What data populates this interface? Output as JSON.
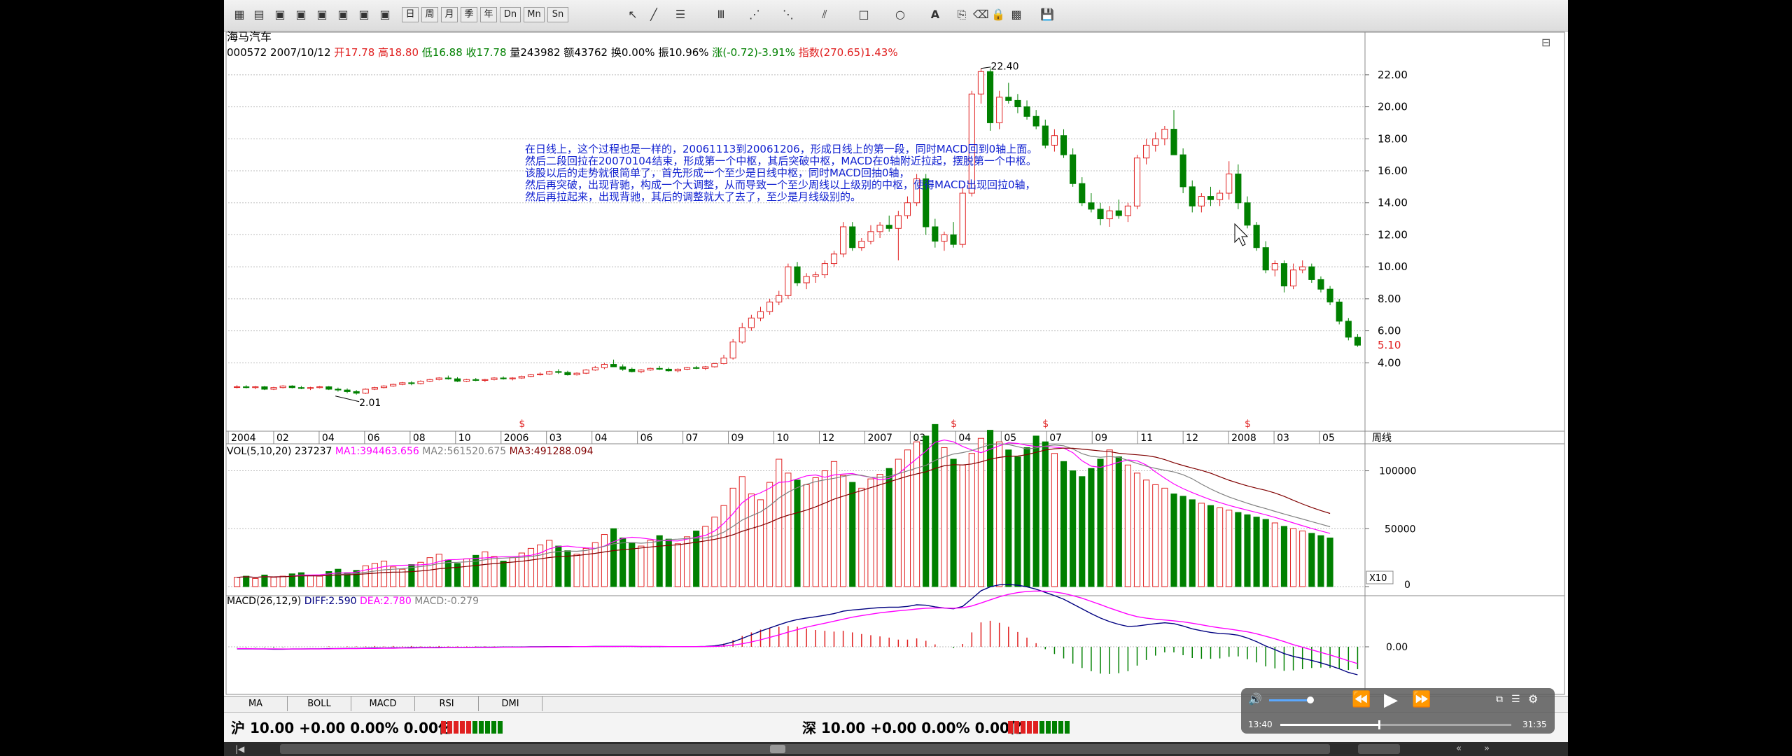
{
  "stock": {
    "name": "海马汽车",
    "code": "000572",
    "date": "2007/10/12",
    "open_label": "开",
    "open": "17.78",
    "high_label": "高",
    "high": "18.80",
    "low_label": "低",
    "low": "16.88",
    "close_label": "收",
    "close": "17.78",
    "vol_label": "量",
    "vol": "243982",
    "amount_label": "额",
    "amount": "43762",
    "turn_label": "换",
    "turn": "0.00%",
    "amp_label": "振",
    "amp": "10.96%",
    "chg_label": "涨",
    "chg": "(-0.72)-3.91%",
    "index_label": "指数",
    "index": "(270.65)1.43%"
  },
  "annotation": [
    "在日线上，这个过程也是一样的，20061113到20061206，形成日线上的第一段，同时MACD回到0轴上面。",
    "然后二段回拉在20070104结束，形成第一个中枢，其后突破中枢，MACD在0轴附近拉起，摆脱第一个中枢。",
    "该股以后的走势就很简单了，首先形成一个至少是日线中枢，同时MACD回抽0轴，",
    "然后再突破，出现背驰，构成一个大调整，从而导致一个至少周线以上级别的中枢，使得MACD出现回拉0轴，",
    "然后再拉起来，出现背驰，其后的调整就大了去了，至少是月线级别的。"
  ],
  "price_labels": {
    "peak": "22.40",
    "low": "2.01",
    "last": "5.10",
    "period": "周线"
  },
  "volume_header": {
    "title": "VOL(5,10,20)",
    "vol": "237237",
    "ma1": "MA1:394463.656",
    "ma2": "MA2:561520.675",
    "ma3": "MA3:491288.094"
  },
  "macd_header": {
    "title": "MACD(26,12,9)",
    "diff": "DIFF:2.590",
    "dea": "DEA:2.780",
    "macd": "MACD:-0.279"
  },
  "volume_axis": {
    "labels": [
      "100000",
      "50000",
      "0"
    ],
    "unit": "X10"
  },
  "macd_axis": {
    "labels": [
      "0.00"
    ]
  },
  "x_axis": {
    "labels": [
      "2004",
      "02",
      "04",
      "06",
      "08",
      "10",
      "2006",
      "03",
      "04",
      "06",
      "07",
      "09",
      "10",
      "12",
      "2007",
      "03",
      "04",
      "05",
      "07",
      "09",
      "11",
      "12",
      "2008",
      "03",
      "05"
    ]
  },
  "tabs": [
    "MA",
    "BOLL",
    "MACD",
    "RSI",
    "DMI"
  ],
  "status": {
    "sh": "沪 10.00 +0.00 0.00% 0.00亿",
    "sz": "深 10.00 +0.00 0.00% 0.00亿"
  },
  "toolbar": {
    "buttons": [
      "日",
      "周",
      "月",
      "季",
      "年",
      "Dn",
      "Mn",
      "Sn"
    ]
  },
  "player": {
    "current": "13:40",
    "total": "31:35"
  },
  "colors": {
    "up": "#e02020",
    "down": "#008000",
    "ma1": "#ff00ff",
    "ma2": "#808080",
    "ma3": "#800000",
    "diff": "#000080",
    "dea": "#ff00ff"
  },
  "chart_data": {
    "type": "candlestick",
    "title": "海马汽车",
    "price_axis": {
      "ylim": [
        2.0,
        23.0
      ],
      "ticks": [
        4,
        6,
        8,
        10,
        12,
        14,
        16,
        18,
        20,
        22
      ]
    },
    "candles": [
      [
        2.5,
        2.6,
        2.4,
        2.5
      ],
      [
        2.5,
        2.6,
        2.4,
        2.45
      ],
      [
        2.45,
        2.55,
        2.35,
        2.5
      ],
      [
        2.5,
        2.55,
        2.3,
        2.35
      ],
      [
        2.35,
        2.5,
        2.3,
        2.45
      ],
      [
        2.45,
        2.6,
        2.4,
        2.55
      ],
      [
        2.55,
        2.6,
        2.4,
        2.45
      ],
      [
        2.45,
        2.55,
        2.35,
        2.4
      ],
      [
        2.4,
        2.5,
        2.3,
        2.45
      ],
      [
        2.45,
        2.55,
        2.4,
        2.5
      ],
      [
        2.5,
        2.55,
        2.3,
        2.35
      ],
      [
        2.35,
        2.45,
        2.2,
        2.3
      ],
      [
        2.3,
        2.4,
        2.1,
        2.2
      ],
      [
        2.2,
        2.3,
        2.01,
        2.1
      ],
      [
        2.1,
        2.4,
        2.05,
        2.35
      ],
      [
        2.35,
        2.5,
        2.3,
        2.45
      ],
      [
        2.45,
        2.6,
        2.4,
        2.55
      ],
      [
        2.55,
        2.7,
        2.5,
        2.65
      ],
      [
        2.65,
        2.8,
        2.6,
        2.75
      ],
      [
        2.75,
        2.85,
        2.6,
        2.7
      ],
      [
        2.7,
        2.9,
        2.65,
        2.85
      ],
      [
        2.85,
        3.0,
        2.8,
        2.95
      ],
      [
        2.95,
        3.1,
        2.9,
        3.05
      ],
      [
        3.05,
        3.2,
        2.95,
        3.0
      ],
      [
        3.0,
        3.1,
        2.8,
        2.85
      ],
      [
        2.85,
        3.0,
        2.8,
        2.95
      ],
      [
        2.95,
        3.05,
        2.85,
        2.9
      ],
      [
        2.9,
        3.0,
        2.8,
        2.95
      ],
      [
        2.95,
        3.1,
        2.9,
        3.05
      ],
      [
        3.05,
        3.15,
        2.95,
        3.0
      ],
      [
        3.0,
        3.1,
        2.9,
        3.05
      ],
      [
        3.05,
        3.2,
        3.0,
        3.15
      ],
      [
        3.15,
        3.3,
        3.1,
        3.25
      ],
      [
        3.25,
        3.4,
        3.2,
        3.3
      ],
      [
        3.3,
        3.5,
        3.25,
        3.45
      ],
      [
        3.45,
        3.6,
        3.3,
        3.4
      ],
      [
        3.4,
        3.5,
        3.2,
        3.25
      ],
      [
        3.25,
        3.4,
        3.2,
        3.35
      ],
      [
        3.35,
        3.6,
        3.3,
        3.55
      ],
      [
        3.55,
        3.8,
        3.5,
        3.7
      ],
      [
        3.7,
        4.0,
        3.6,
        3.9
      ],
      [
        3.9,
        4.2,
        3.8,
        3.75
      ],
      [
        3.75,
        3.9,
        3.5,
        3.6
      ],
      [
        3.6,
        3.7,
        3.4,
        3.45
      ],
      [
        3.45,
        3.6,
        3.35,
        3.55
      ],
      [
        3.55,
        3.7,
        3.5,
        3.65
      ],
      [
        3.65,
        3.8,
        3.55,
        3.6
      ],
      [
        3.6,
        3.7,
        3.45,
        3.5
      ],
      [
        3.5,
        3.65,
        3.4,
        3.6
      ],
      [
        3.6,
        3.75,
        3.55,
        3.7
      ],
      [
        3.7,
        3.8,
        3.6,
        3.65
      ],
      [
        3.65,
        3.8,
        3.55,
        3.75
      ],
      [
        3.75,
        4.0,
        3.7,
        3.95
      ],
      [
        3.95,
        4.5,
        3.9,
        4.3
      ],
      [
        4.3,
        5.5,
        4.2,
        5.3
      ],
      [
        5.3,
        6.5,
        5.2,
        6.2
      ],
      [
        6.2,
        7.0,
        6.0,
        6.8
      ],
      [
        6.8,
        7.5,
        6.6,
        7.2
      ],
      [
        7.2,
        8.0,
        7.0,
        7.8
      ],
      [
        7.8,
        8.5,
        7.6,
        8.2
      ],
      [
        8.2,
        10.2,
        8.0,
        10.0
      ],
      [
        10.0,
        10.3,
        8.8,
        9.0
      ],
      [
        9.0,
        9.6,
        8.6,
        9.4
      ],
      [
        9.4,
        9.7,
        9.0,
        9.5
      ],
      [
        9.5,
        10.4,
        9.3,
        10.2
      ],
      [
        10.2,
        11.0,
        10.0,
        10.8
      ],
      [
        10.8,
        12.8,
        10.6,
        12.5
      ],
      [
        12.5,
        12.8,
        11.0,
        11.2
      ],
      [
        11.2,
        11.8,
        11.0,
        11.6
      ],
      [
        11.6,
        12.6,
        11.4,
        12.2
      ],
      [
        12.2,
        12.8,
        11.8,
        12.6
      ],
      [
        12.6,
        13.2,
        12.2,
        12.4
      ],
      [
        12.4,
        13.5,
        10.4,
        13.2
      ],
      [
        13.2,
        14.4,
        13.0,
        14.0
      ],
      [
        14.0,
        15.8,
        13.8,
        15.5
      ],
      [
        15.5,
        15.8,
        12.0,
        12.5
      ],
      [
        12.5,
        13.0,
        11.2,
        11.6
      ],
      [
        11.6,
        12.2,
        11.0,
        12.0
      ],
      [
        12.0,
        12.8,
        11.2,
        11.4
      ],
      [
        11.4,
        15.0,
        11.2,
        14.6
      ],
      [
        14.6,
        21.0,
        14.4,
        20.8
      ],
      [
        20.8,
        22.4,
        20.2,
        22.2
      ],
      [
        22.2,
        22.4,
        18.5,
        19.0
      ],
      [
        19.0,
        21.0,
        18.6,
        20.6
      ],
      [
        20.6,
        21.5,
        20.2,
        20.4
      ],
      [
        20.4,
        20.8,
        19.6,
        20.0
      ],
      [
        20.0,
        20.4,
        19.2,
        19.4
      ],
      [
        19.4,
        19.8,
        18.6,
        18.8
      ],
      [
        18.8,
        19.2,
        17.4,
        17.6
      ],
      [
        17.6,
        18.6,
        17.2,
        18.2
      ],
      [
        18.2,
        18.6,
        16.8,
        17.0
      ],
      [
        17.0,
        17.4,
        15.0,
        15.2
      ],
      [
        15.2,
        15.6,
        13.8,
        14.0
      ],
      [
        14.0,
        14.6,
        13.4,
        13.6
      ],
      [
        13.6,
        14.0,
        12.6,
        13.0
      ],
      [
        13.0,
        13.8,
        12.5,
        13.5
      ],
      [
        13.5,
        14.2,
        13.0,
        13.2
      ],
      [
        13.2,
        14.0,
        12.8,
        13.8
      ],
      [
        13.8,
        17.0,
        13.6,
        16.8
      ],
      [
        16.8,
        18.0,
        16.4,
        17.6
      ],
      [
        17.6,
        18.4,
        17.2,
        18.0
      ],
      [
        18.0,
        18.8,
        17.6,
        18.6
      ],
      [
        18.6,
        19.8,
        18.0,
        17.0
      ],
      [
        17.0,
        17.4,
        14.6,
        15.0
      ],
      [
        15.0,
        15.4,
        13.4,
        13.8
      ],
      [
        13.8,
        14.6,
        13.4,
        14.4
      ],
      [
        14.4,
        15.0,
        13.8,
        14.2
      ],
      [
        14.2,
        14.8,
        13.8,
        14.6
      ],
      [
        14.6,
        16.6,
        14.2,
        15.8
      ],
      [
        15.8,
        16.4,
        13.6,
        14.0
      ],
      [
        14.0,
        14.4,
        12.4,
        12.6
      ],
      [
        12.6,
        12.8,
        11.0,
        11.2
      ],
      [
        11.2,
        11.6,
        9.6,
        9.8
      ],
      [
        9.8,
        10.4,
        9.4,
        10.2
      ],
      [
        10.2,
        10.4,
        8.4,
        8.8
      ],
      [
        8.8,
        10.2,
        8.6,
        9.8
      ],
      [
        9.8,
        10.4,
        9.6,
        10.0
      ],
      [
        10.0,
        10.2,
        9.0,
        9.2
      ],
      [
        9.2,
        9.4,
        8.4,
        8.6
      ],
      [
        8.6,
        8.8,
        7.6,
        7.8
      ],
      [
        7.8,
        8.0,
        6.4,
        6.6
      ],
      [
        6.6,
        6.8,
        5.4,
        5.6
      ],
      [
        5.6,
        5.8,
        5.0,
        5.1
      ]
    ],
    "volume": [
      8,
      9,
      7,
      10,
      8,
      9,
      11,
      12,
      10,
      9,
      13,
      15,
      12,
      14,
      18,
      20,
      22,
      17,
      15,
      19,
      21,
      25,
      28,
      23,
      20,
      24,
      27,
      30,
      26,
      22,
      25,
      29,
      33,
      36,
      40,
      35,
      31,
      28,
      33,
      38,
      45,
      50,
      42,
      38,
      35,
      40,
      44,
      41,
      37,
      43,
      48,
      52,
      60,
      70,
      85,
      95,
      80,
      75,
      90,
      110,
      98,
      92,
      88,
      94,
      100,
      108,
      96,
      90,
      85,
      93,
      97,
      102,
      110,
      118,
      125,
      130,
      140,
      120,
      110,
      105,
      115,
      128,
      135,
      125,
      118,
      112,
      120,
      130,
      125,
      115,
      108,
      100,
      95,
      102,
      110,
      118,
      112,
      105,
      98,
      92,
      88,
      85,
      80,
      78,
      75,
      72,
      70,
      68,
      66,
      64,
      62,
      60,
      58,
      55,
      52,
      50,
      48,
      46,
      44,
      42
    ],
    "macd_diff": [
      -0.1,
      -0.1,
      -0.11,
      -0.11,
      -0.12,
      -0.12,
      -0.11,
      -0.11,
      -0.1,
      -0.1,
      -0.09,
      -0.09,
      -0.08,
      -0.08,
      -0.07,
      -0.06,
      -0.06,
      -0.05,
      -0.05,
      -0.04,
      -0.04,
      -0.04,
      -0.03,
      -0.03,
      -0.03,
      -0.03,
      -0.02,
      -0.02,
      -0.02,
      -0.01,
      -0.01,
      -0.01,
      0.0,
      0.0,
      0.01,
      0.01,
      0.01,
      0.01,
      0.01,
      0.02,
      0.02,
      0.02,
      0.02,
      0.02,
      0.01,
      0.01,
      0.01,
      0.01,
      0.01,
      0.01,
      0.01,
      0.02,
      0.05,
      0.12,
      0.25,
      0.42,
      0.6,
      0.78,
      0.94,
      1.1,
      1.25,
      1.36,
      1.44,
      1.5,
      1.58,
      1.66,
      1.78,
      1.84,
      1.88,
      1.92,
      1.96,
      1.98,
      1.98,
      2.02,
      2.1,
      2.08,
      2.0,
      1.94,
      1.9,
      2.02,
      2.4,
      2.8,
      3.0,
      3.1,
      3.12,
      3.08,
      3.0,
      2.88,
      2.72,
      2.56,
      2.38,
      2.14,
      1.9,
      1.66,
      1.44,
      1.26,
      1.12,
      1.02,
      1.04,
      1.1,
      1.16,
      1.2,
      1.16,
      1.04,
      0.9,
      0.8,
      0.72,
      0.66,
      0.64,
      0.58,
      0.44,
      0.26,
      0.04,
      -0.14,
      -0.34,
      -0.48,
      -0.58,
      -0.68,
      -0.8,
      -0.94,
      -1.1,
      -1.28,
      -1.4
    ],
    "macd_dea": [
      -0.09,
      -0.09,
      -0.1,
      -0.1,
      -0.1,
      -0.11,
      -0.11,
      -0.11,
      -0.1,
      -0.1,
      -0.1,
      -0.09,
      -0.09,
      -0.09,
      -0.08,
      -0.08,
      -0.07,
      -0.07,
      -0.06,
      -0.06,
      -0.05,
      -0.05,
      -0.05,
      -0.04,
      -0.04,
      -0.04,
      -0.03,
      -0.03,
      -0.03,
      -0.02,
      -0.02,
      -0.02,
      -0.01,
      -0.01,
      0.0,
      0.0,
      0.0,
      0.01,
      0.01,
      0.01,
      0.01,
      0.01,
      0.02,
      0.02,
      0.02,
      0.02,
      0.02,
      0.01,
      0.01,
      0.01,
      0.01,
      0.01,
      0.02,
      0.04,
      0.08,
      0.15,
      0.24,
      0.35,
      0.47,
      0.6,
      0.73,
      0.86,
      0.98,
      1.08,
      1.18,
      1.28,
      1.38,
      1.48,
      1.56,
      1.63,
      1.7,
      1.75,
      1.8,
      1.84,
      1.89,
      1.93,
      1.94,
      1.94,
      1.93,
      1.95,
      2.04,
      2.19,
      2.35,
      2.5,
      2.62,
      2.71,
      2.77,
      2.79,
      2.78,
      2.74,
      2.67,
      2.56,
      2.43,
      2.27,
      2.11,
      1.94,
      1.78,
      1.63,
      1.51,
      1.43,
      1.38,
      1.34,
      1.3,
      1.25,
      1.18,
      1.1,
      1.02,
      0.95,
      0.89,
      0.82,
      0.75,
      0.65,
      0.53,
      0.4,
      0.26,
      0.11,
      -0.02,
      -0.15,
      -0.28,
      -0.41,
      -0.55,
      -0.7,
      -0.84
    ]
  }
}
